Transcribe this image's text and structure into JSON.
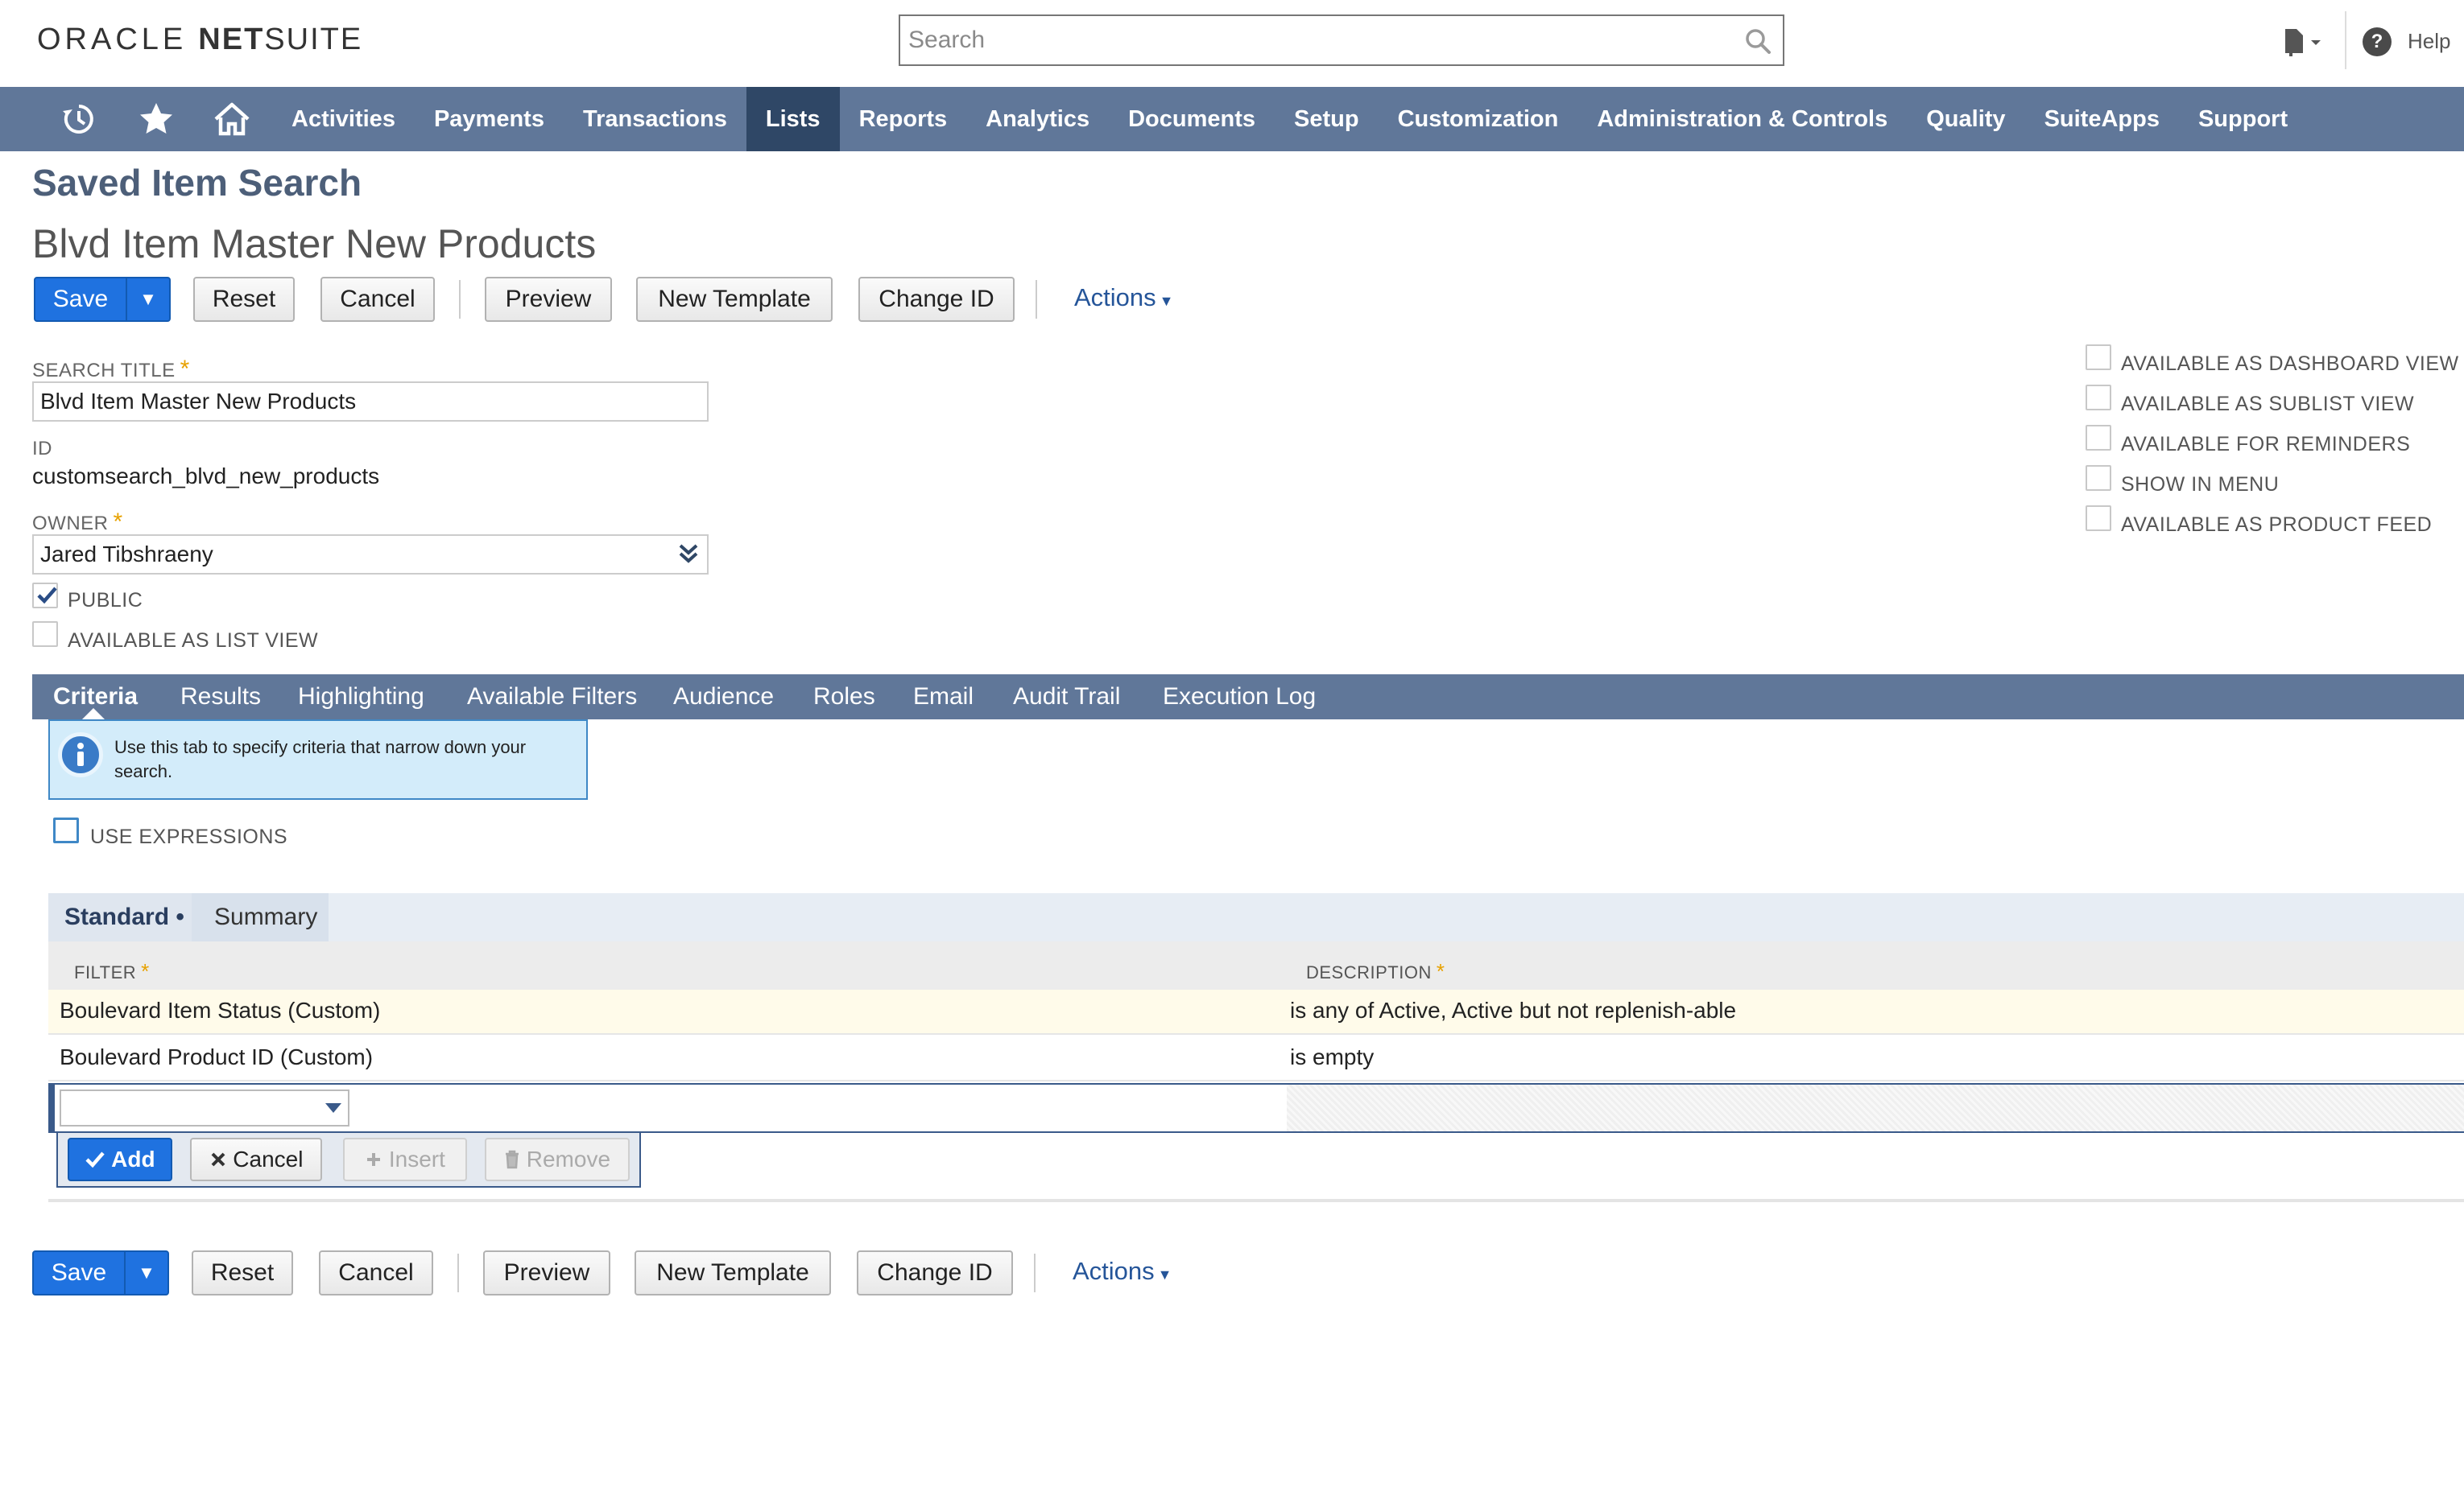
{
  "header": {
    "logo_oracle": "ORACLE",
    "logo_net": "NET",
    "logo_suite": "SUITE",
    "search_placeholder": "Search",
    "help_label": "Help",
    "icons": [
      "search-icon",
      "document-icon",
      "help-icon"
    ]
  },
  "nav": {
    "icons": [
      "recent-icon",
      "star-icon",
      "home-icon"
    ],
    "items": [
      "Activities",
      "Payments",
      "Transactions",
      "Lists",
      "Reports",
      "Analytics",
      "Documents",
      "Setup",
      "Customization",
      "Administration & Controls",
      "Quality",
      "SuiteApps",
      "Support"
    ],
    "active": "Lists"
  },
  "page": {
    "type": "Saved Item Search",
    "title": "Blvd Item Master New Products"
  },
  "buttons": {
    "save": "Save",
    "save_arrow": "▼",
    "reset": "Reset",
    "cancel": "Cancel",
    "preview": "Preview",
    "new_template": "New Template",
    "change_id": "Change ID",
    "actions": "Actions"
  },
  "form": {
    "search_title_label": "SEARCH TITLE",
    "search_title_value": "Blvd Item Master New Products",
    "id_label": "ID",
    "id_value": "customsearch_blvd_new_products",
    "owner_label": "OWNER",
    "owner_value": "Jared Tibshraeny",
    "public_label": "PUBLIC",
    "public_checked": true,
    "list_view_label": "AVAILABLE AS LIST VIEW",
    "list_view_checked": false,
    "right_options": [
      {
        "label": "AVAILABLE AS DASHBOARD VIEW",
        "checked": false
      },
      {
        "label": "AVAILABLE AS SUBLIST VIEW",
        "checked": false
      },
      {
        "label": "AVAILABLE FOR REMINDERS",
        "checked": false
      },
      {
        "label": "SHOW IN MENU",
        "checked": false
      },
      {
        "label": "AVAILABLE AS PRODUCT FEED",
        "checked": false
      }
    ]
  },
  "subtabs": {
    "items": [
      "Criteria",
      "Results",
      "Highlighting",
      "Available Filters",
      "Audience",
      "Roles",
      "Email",
      "Audit Trail",
      "Execution Log"
    ],
    "active": "Criteria"
  },
  "criteria": {
    "info_text": "Use this tab to specify criteria that narrow down your search.",
    "use_expressions_label": "USE EXPRESSIONS",
    "use_expressions_checked": false,
    "tabs": [
      "Standard",
      "Summary"
    ],
    "standard_marker": "•",
    "columns": {
      "filter": "FILTER",
      "description": "DESCRIPTION"
    },
    "rows": [
      {
        "filter": "Boulevard Item Status (Custom)",
        "description": "is any of Active, Active but not replenish-able"
      },
      {
        "filter": "Boulevard Product ID (Custom)",
        "description": "is empty"
      }
    ],
    "edit_buttons": {
      "add": "Add",
      "cancel": "Cancel",
      "insert": "Insert",
      "remove": "Remove"
    }
  },
  "colors": {
    "navbar": "#607799",
    "navbar_active": "#2f4766",
    "primary_button": "#1f72e0",
    "title": "#4d5f79",
    "link": "#255599",
    "required": "#e7a100",
    "info_bg": "#d3ecfa",
    "row_highlight": "#fffbea"
  }
}
